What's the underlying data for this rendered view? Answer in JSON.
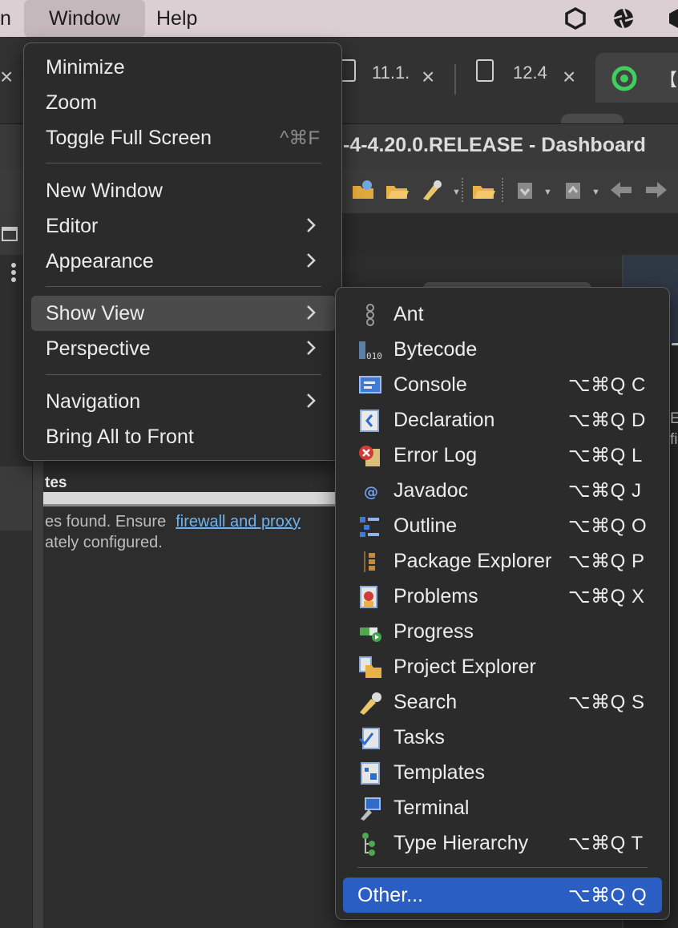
{
  "menubar": {
    "partial_item": "n",
    "window": "Window",
    "help": "Help",
    "tray_icons": [
      "hexagon-icon",
      "aperture-icon",
      "hexagon-partial-icon"
    ]
  },
  "tabs": {
    "left_close": "×",
    "tab1_label": "11.1.",
    "tab1_close": "×",
    "tab2_label": "12.4",
    "tab2_close": "×",
    "active_tab_text": "【i"
  },
  "window_title": "-4-4.20.0.RELEASE - Dashboard",
  "dashboard": {
    "updates_heading": "tes",
    "message_line1": "es found. Ensure",
    "link_text": "firewall and proxy",
    "message_line2": "ately configured.",
    "right_text_1": "E",
    "right_text_2": "fi"
  },
  "window_menu": {
    "items": [
      {
        "label": "Minimize"
      },
      {
        "label": "Zoom"
      },
      {
        "label": "Toggle Full Screen",
        "shortcut": "^⌘F"
      },
      {
        "label": "New Window"
      },
      {
        "label": "Editor",
        "submenu": true
      },
      {
        "label": "Appearance",
        "submenu": true
      },
      {
        "label": "Show View",
        "submenu": true,
        "highlighted": true
      },
      {
        "label": "Perspective",
        "submenu": true
      },
      {
        "label": "Navigation",
        "submenu": true
      },
      {
        "label": "Bring All to Front"
      }
    ]
  },
  "show_view_menu": {
    "items": [
      {
        "label": "Ant",
        "icon": "ant-icon",
        "shortcut": ""
      },
      {
        "label": "Bytecode",
        "icon": "bytecode-icon",
        "shortcut": ""
      },
      {
        "label": "Console",
        "icon": "console-icon",
        "shortcut": "⌥⌘Q C"
      },
      {
        "label": "Declaration",
        "icon": "declaration-icon",
        "shortcut": "⌥⌘Q D"
      },
      {
        "label": "Error Log",
        "icon": "error-log-icon",
        "shortcut": "⌥⌘Q L"
      },
      {
        "label": "Javadoc",
        "icon": "javadoc-icon",
        "shortcut": "⌥⌘Q J"
      },
      {
        "label": "Outline",
        "icon": "outline-icon",
        "shortcut": "⌥⌘Q O"
      },
      {
        "label": "Package Explorer",
        "icon": "package-explorer-icon",
        "shortcut": "⌥⌘Q P"
      },
      {
        "label": "Problems",
        "icon": "problems-icon",
        "shortcut": "⌥⌘Q X"
      },
      {
        "label": "Progress",
        "icon": "progress-icon",
        "shortcut": ""
      },
      {
        "label": "Project Explorer",
        "icon": "project-explorer-icon",
        "shortcut": ""
      },
      {
        "label": "Search",
        "icon": "search-icon",
        "shortcut": "⌥⌘Q S"
      },
      {
        "label": "Tasks",
        "icon": "tasks-icon",
        "shortcut": ""
      },
      {
        "label": "Templates",
        "icon": "templates-icon",
        "shortcut": ""
      },
      {
        "label": "Terminal",
        "icon": "terminal-icon",
        "shortcut": ""
      },
      {
        "label": "Type Hierarchy",
        "icon": "type-hierarchy-icon",
        "shortcut": "⌥⌘Q T"
      }
    ],
    "other": {
      "label": "Other...",
      "shortcut": "⌥⌘Q Q",
      "selected": true
    }
  },
  "colors": {
    "menubar_bg": "#dccfd3",
    "menu_bg": "#2b2b2b",
    "highlight": "#4b4b4b",
    "selection": "#2a5ec2",
    "link": "#6eb3f0"
  }
}
